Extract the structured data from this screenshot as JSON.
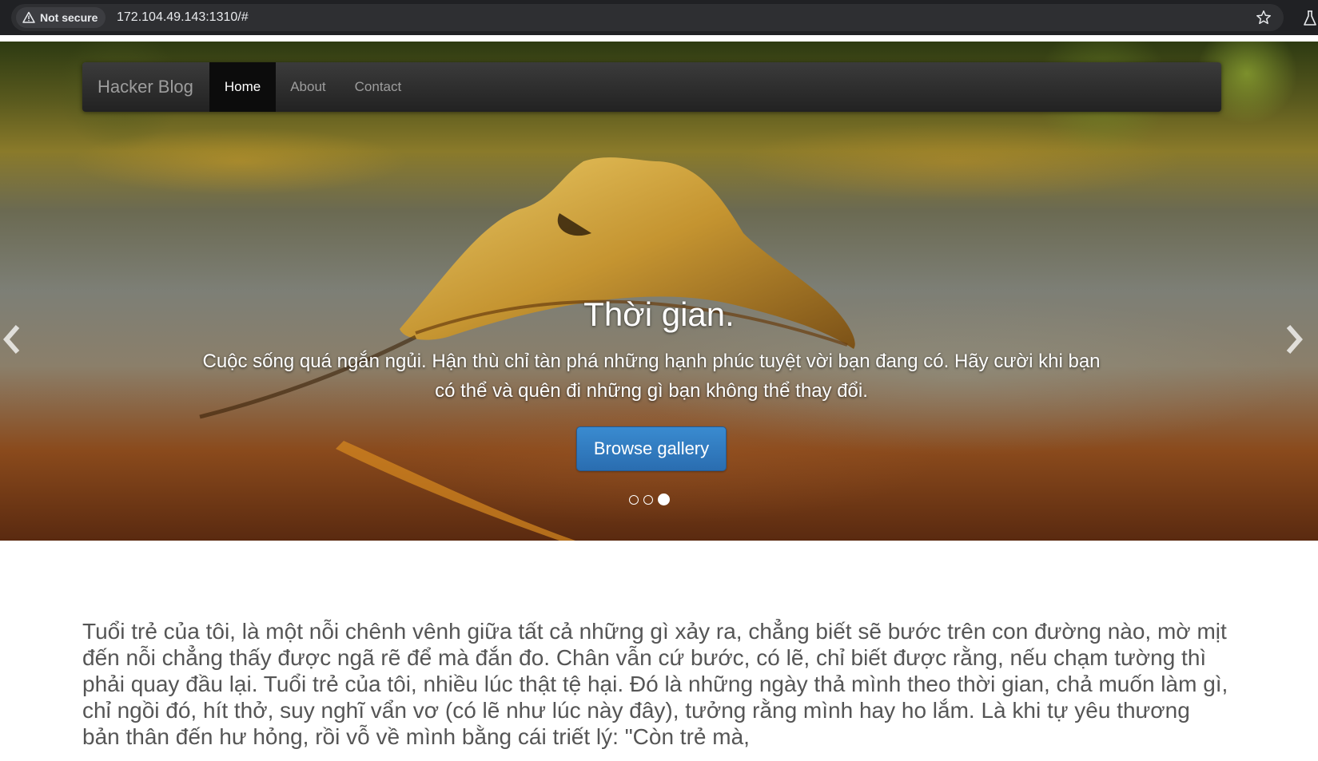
{
  "browser": {
    "security_label": "Not secure",
    "url": "172.104.49.143:1310/#",
    "icons": [
      "warning-icon",
      "star-icon",
      "labs-icon"
    ]
  },
  "navbar": {
    "brand": "Hacker Blog",
    "items": [
      {
        "label": "Home",
        "active": true
      },
      {
        "label": "About",
        "active": false
      },
      {
        "label": "Contact",
        "active": false
      }
    ]
  },
  "carousel": {
    "title": "Thời gian.",
    "text": "Cuộc sống quá ngắn ngủi. Hận thù chỉ tàn phá những hạnh phúc tuyệt vời bạn đang có. Hãy cười khi bạn có thể và quên đi những gì bạn không thể thay đổi.",
    "button_label": "Browse gallery",
    "slide_count": 3,
    "active_slide": 3,
    "colors": {
      "button": "#2a6db0",
      "navbar": "#222222"
    }
  },
  "article": {
    "text": "Tuổi trẻ của tôi, là một nỗi chênh vênh giữa tất cả những gì xảy ra, chẳng biết sẽ bước trên con đường nào, mờ mịt đến nỗi chẳng thấy được ngã rẽ để mà đắn đo. Chân vẫn cứ bước, có lẽ, chỉ biết được rằng, nếu chạm tường thì phải quay đầu lại. Tuổi trẻ của tôi, nhiều lúc thật tệ hại. Đó là những ngày thả mình theo thời gian, chả muốn làm gì, chỉ ngồi đó, hít thở, suy nghĩ vẩn vơ (có lẽ như lúc này đây), tưởng rằng mình hay ho lắm. Là khi tự yêu thương bản thân đến hư hỏng, rồi vỗ về mình bằng cái triết lý: \"Còn trẻ mà,"
  }
}
